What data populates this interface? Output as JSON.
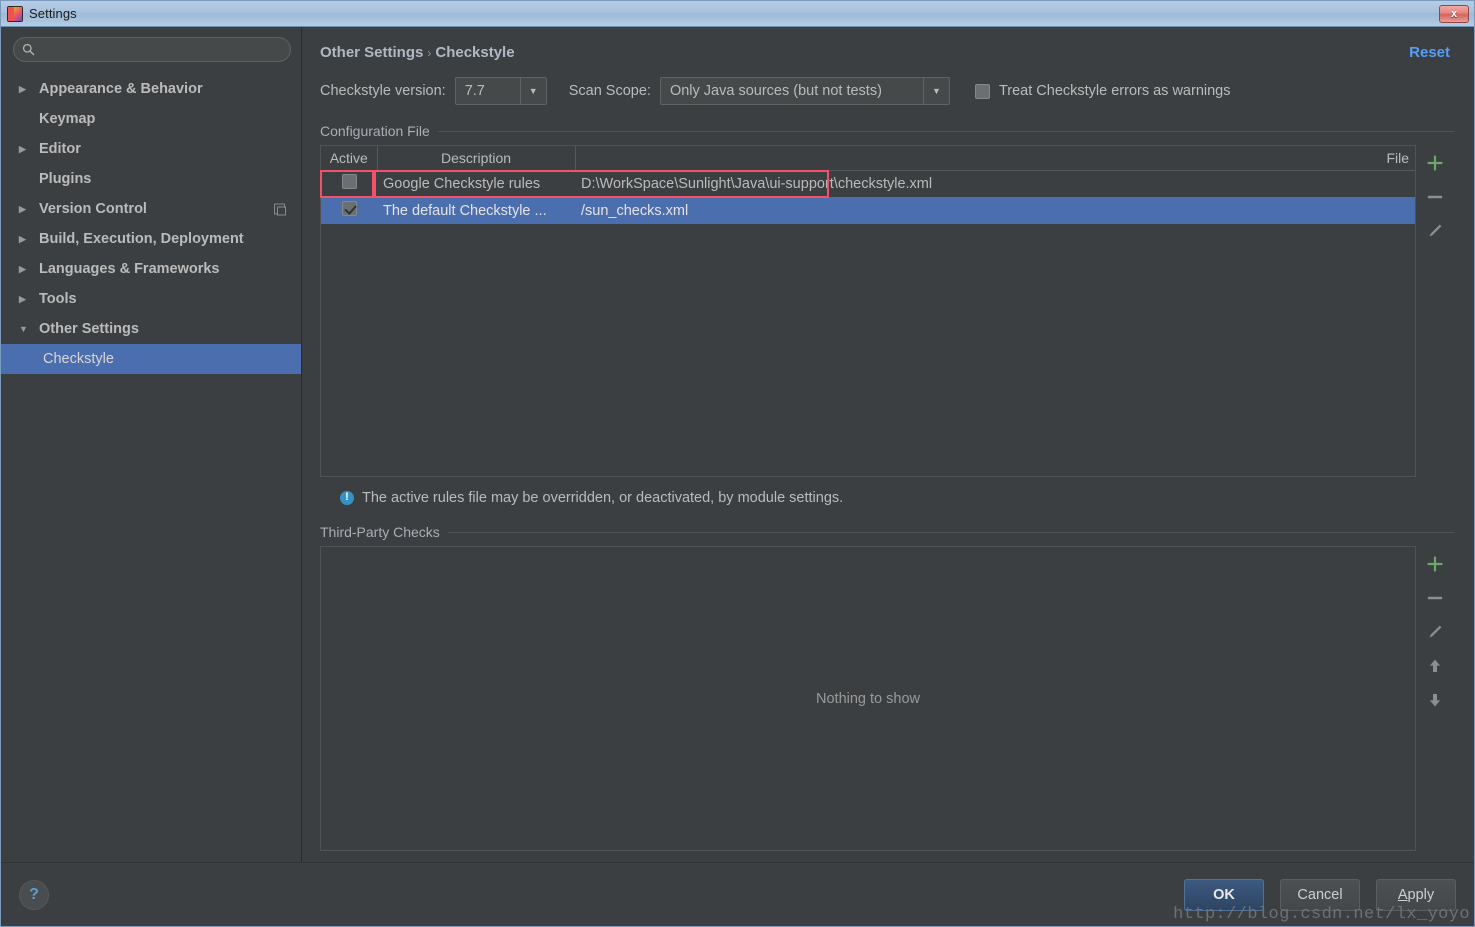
{
  "window": {
    "title": "Settings",
    "app_icon": "intellij-idea-icon",
    "close_label": "x"
  },
  "search": {
    "value": "",
    "placeholder": "",
    "icon": "search-icon"
  },
  "sidebar": {
    "items": [
      {
        "label": "Appearance & Behavior",
        "expandable": true,
        "expanded": false,
        "child": false,
        "selected": false,
        "badge": false
      },
      {
        "label": "Keymap",
        "expandable": false,
        "expanded": false,
        "child": false,
        "selected": false,
        "badge": false
      },
      {
        "label": "Editor",
        "expandable": true,
        "expanded": false,
        "child": false,
        "selected": false,
        "badge": false
      },
      {
        "label": "Plugins",
        "expandable": false,
        "expanded": false,
        "child": false,
        "selected": false,
        "badge": false
      },
      {
        "label": "Version Control",
        "expandable": true,
        "expanded": false,
        "child": false,
        "selected": false,
        "badge": true
      },
      {
        "label": "Build, Execution, Deployment",
        "expandable": true,
        "expanded": false,
        "child": false,
        "selected": false,
        "badge": false
      },
      {
        "label": "Languages & Frameworks",
        "expandable": true,
        "expanded": false,
        "child": false,
        "selected": false,
        "badge": false
      },
      {
        "label": "Tools",
        "expandable": true,
        "expanded": false,
        "child": false,
        "selected": false,
        "badge": false
      },
      {
        "label": "Other Settings",
        "expandable": true,
        "expanded": true,
        "child": false,
        "selected": false,
        "badge": false
      },
      {
        "label": "Checkstyle",
        "expandable": false,
        "expanded": false,
        "child": true,
        "selected": true,
        "badge": false
      }
    ]
  },
  "header": {
    "breadcrumb_root": "Other Settings",
    "breadcrumb_sep": "›",
    "breadcrumb_leaf": "Checkstyle",
    "reset_label": "Reset"
  },
  "toolbar": {
    "version_label": "Checkstyle version:",
    "version_value": "7.7",
    "scope_label": "Scan Scope:",
    "scope_value": "Only Java sources (but not tests)",
    "treat_errors_label": "Treat Checkstyle errors as warnings",
    "treat_errors_checked": false
  },
  "config_section": {
    "title": "Configuration File",
    "columns": [
      "Active",
      "Description",
      "File"
    ],
    "rows": [
      {
        "active": false,
        "description": "Google Checkstyle rules",
        "file": "D:\\WorkSpace\\Sunlight\\Java\\ui-support\\checkstyle.xml",
        "selected": false
      },
      {
        "active": true,
        "description": "The default Checkstyle ...",
        "file": "/sun_checks.xml",
        "selected": true
      }
    ],
    "tools": [
      "add-icon",
      "remove-icon",
      "edit-icon"
    ],
    "info_text": "The active rules file may be overridden, or deactivated, by module settings."
  },
  "third_party_section": {
    "title": "Third-Party Checks",
    "empty_text": "Nothing to show",
    "tools": [
      "add-icon",
      "remove-icon",
      "edit-icon",
      "move-up-icon",
      "move-down-icon"
    ]
  },
  "footer": {
    "help_label": "?",
    "ok_label": "OK",
    "cancel_label": "Cancel",
    "apply_label_underlined": "A",
    "apply_label_rest": "pply"
  },
  "watermark": "http://blog.csdn.net/lx_yoyo",
  "colors": {
    "accent_selection": "#4b6eaf",
    "link": "#589df6",
    "annotation": "#f4506a",
    "add_icon": "#6ca76c",
    "info": "#3592c4"
  }
}
